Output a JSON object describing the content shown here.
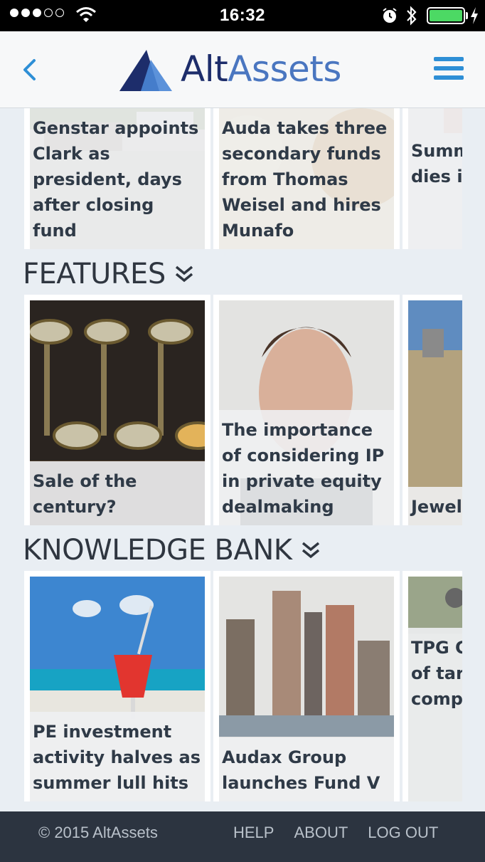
{
  "status_bar": {
    "time": "16:32",
    "signal_icon": "signal-dots-icon",
    "wifi_icon": "wifi-icon",
    "alarm_icon": "alarm-icon",
    "bluetooth_icon": "bluetooth-icon",
    "battery_icon": "battery-icon",
    "charging_icon": "charging-bolt-icon"
  },
  "header": {
    "back_icon": "chevron-left-icon",
    "logo_part1": "Alt",
    "logo_part2": "Assets",
    "menu_icon": "hamburger-menu-icon",
    "brand_color": "#2e8fd6"
  },
  "top_row": {
    "cards": [
      {
        "title": "Genstar appoints Clark as president, days after closing fund"
      },
      {
        "title": "Auda takes three secondary funds from Thomas Weisel and hires Munafo"
      },
      {
        "title": "Summit exec J dies in plane"
      }
    ]
  },
  "features": {
    "heading": "FEATURES",
    "cards": [
      {
        "title": "Sale of the century?"
      },
      {
        "title": "The importance of considering IP in private equity dealmaking"
      },
      {
        "title": "Jewel crown"
      }
    ]
  },
  "knowledge_bank": {
    "heading": "KNOWLEDGE BANK",
    "cards": [
      {
        "title": "PE investment activity halves as summer lull hits"
      },
      {
        "title": "Audax Group launches Fund V"
      },
      {
        "title": "TPG C up to IPO of target tech, comp"
      }
    ]
  },
  "footer": {
    "copyright": "© 2015 AltAssets",
    "links": [
      "HELP",
      "ABOUT",
      "LOG OUT"
    ]
  }
}
